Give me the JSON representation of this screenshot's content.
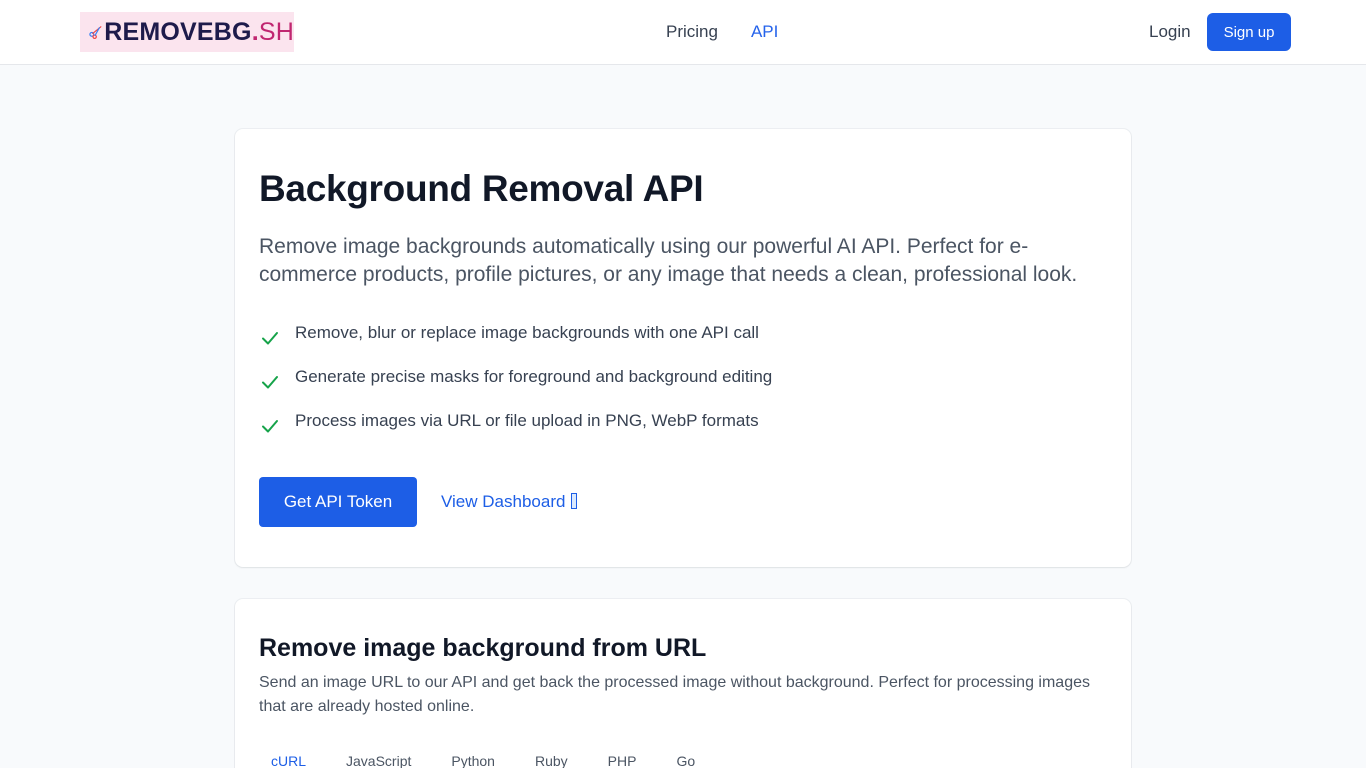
{
  "header": {
    "logo": {
      "text": "REMOVEBG",
      "sep": ".",
      "tld": "SH"
    },
    "nav": [
      {
        "label": "Pricing",
        "active": false
      },
      {
        "label": "API",
        "active": true
      }
    ],
    "login_label": "Login",
    "signup_label": "Sign up"
  },
  "hero": {
    "title": "Background Removal API",
    "lead": "Remove image backgrounds automatically using our powerful AI API. Perfect for e-commerce products, profile pictures, or any image that needs a clean, professional look.",
    "features": [
      "Remove, blur or replace image backgrounds with one API call",
      "Generate precise masks for foreground and background editing",
      "Process images via URL or file upload in PNG, WebP formats"
    ],
    "primary_button": "Get API Token",
    "secondary_link": "View Dashboard"
  },
  "url_section": {
    "title": "Remove image background from URL",
    "description": "Send an image URL to our API and get back the processed image without background. Perfect for processing images that are already hosted online.",
    "tabs": [
      {
        "label": "cURL",
        "active": true
      },
      {
        "label": "JavaScript",
        "active": false
      },
      {
        "label": "Python",
        "active": false
      },
      {
        "label": "Ruby",
        "active": false
      },
      {
        "label": "PHP",
        "active": false
      },
      {
        "label": "Go",
        "active": false
      }
    ]
  },
  "colors": {
    "accent": "#1d5ee6",
    "check": "#16a34a",
    "logo_bg": "#fbe4ee"
  },
  "icons": {
    "logo": "scissors-icon",
    "feature": "check-icon"
  }
}
